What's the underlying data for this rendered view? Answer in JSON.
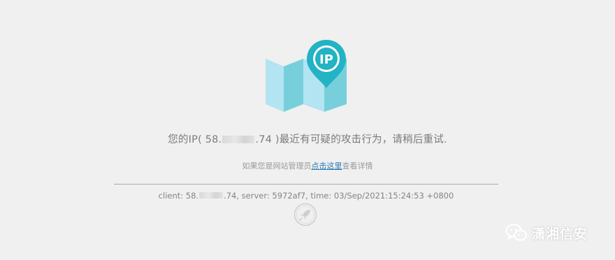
{
  "illustration": {
    "pin_label": "IP",
    "icon": "map-pin-icon"
  },
  "message": {
    "prefix": "您的IP( 58.",
    "suffix": ".74 )最近有可疑的攻击行为，请稍后重试."
  },
  "admin": {
    "prefix": "如果您是网站管理员",
    "link": "点击这里",
    "suffix": "查看详情"
  },
  "client_info": {
    "prefix": "client: 58.",
    "suffix": ".74, server: 5972af7, time: 03/Sep/2021:15:24:53 +0800"
  },
  "footer_icon": "rocket-icon",
  "watermark": {
    "text": "潇湘信安",
    "icon": "wechat-icon"
  },
  "colors": {
    "background": "#eff0ef",
    "map_light": "#b2e4f1",
    "map_dark": "#78cfdc",
    "pin": "#22b3c4",
    "link": "#2b79b5"
  }
}
